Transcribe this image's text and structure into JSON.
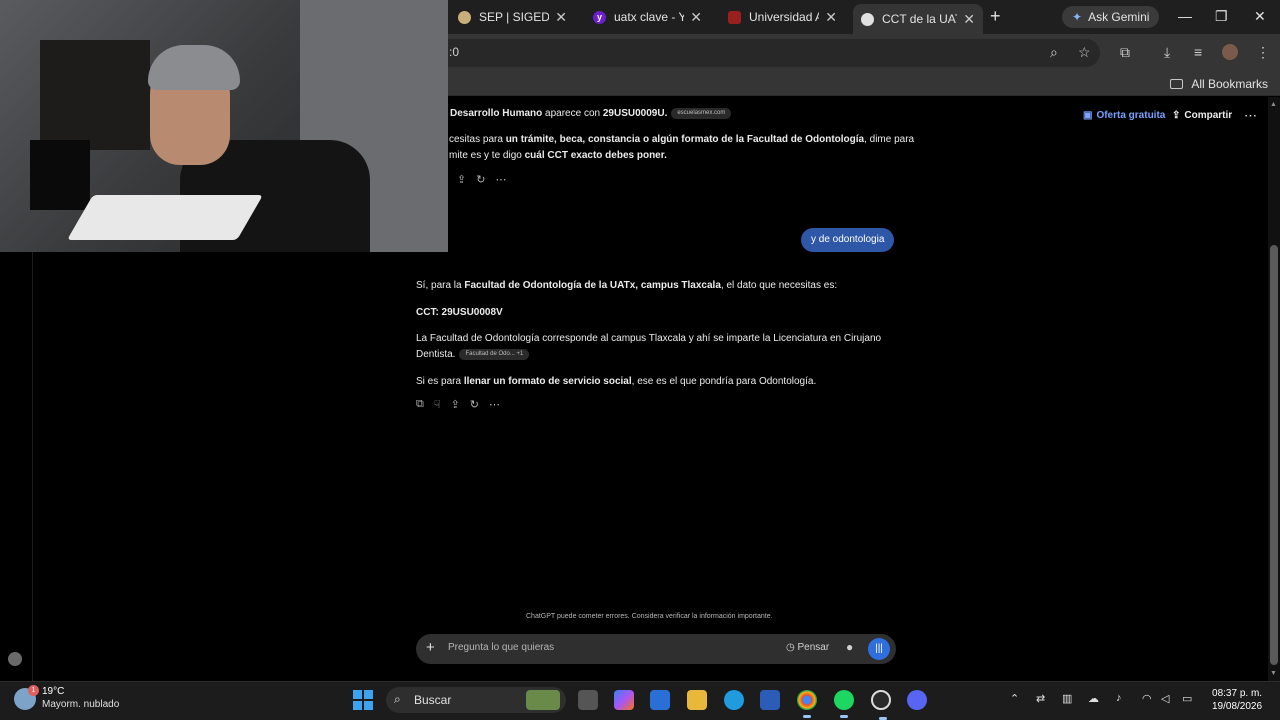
{
  "browser": {
    "tabs": [
      {
        "title": "SEP | SIGED",
        "close": "✕"
      },
      {
        "title": "uatx clave - Yaho",
        "close": "✕"
      },
      {
        "title": "Universidad Autó",
        "close": "✕"
      },
      {
        "title": "CCT de la UATx",
        "close": "✕"
      }
    ],
    "new_tab": "+",
    "ask_gemini": "Ask Gemini",
    "window_controls": {
      "minimize": "—",
      "maximize": "❐",
      "close": "✕"
    },
    "omnibox_text": ":0",
    "all_bookmarks": "All Bookmarks"
  },
  "chat_header": {
    "offer": "Oferta gratuita",
    "share": "Compartir",
    "more": "⋯"
  },
  "chat": {
    "prev_line_1a": "Desarrollo Humano",
    "prev_line_1b": " aparece con ",
    "prev_line_1c": "29USU0009U.",
    "prev_cite": "escuelasmex.com",
    "prev_line_2a": "cesitas para ",
    "prev_line_2b": "un trámite, beca, constancia o algún formato de la Facultad de Odontología",
    "prev_line_2c": ", dime para",
    "prev_line_3a": "mite es y te digo ",
    "prev_line_3b": "cuál CCT exacto debes poner.",
    "user_message": "y de odontologia",
    "r1a": "Sí, para la ",
    "r1b": "Facultad de Odontología de la UATx, campus Tlaxcala",
    "r1c": ", el dato que necesitas es:",
    "r2": "CCT: 29USU0008V",
    "r3": "La Facultad de Odontología corresponde al campus Tlaxcala y ahí se imparte la Licenciatura en Cirujano",
    "r4": "Dentista.",
    "r4_cite": "Facultad de Odo... +1",
    "r5a": "Si es para ",
    "r5b": "llenar un formato de servicio social",
    "r5c": ", ese es el que pondría para Odontología.",
    "disclaimer": "ChatGPT puede cometer errores. Considera verificar la información importante.",
    "composer_placeholder": "Pregunta lo que quieras",
    "think_label": "Pensar"
  },
  "taskbar": {
    "temperature": "19°C",
    "weather": "Mayorm. nublado",
    "weather_badge": "1",
    "search": "Buscar",
    "time": "08:37 p. m.",
    "date": "19/08/2026"
  },
  "colors": {
    "accent_blue": "#2f57a8",
    "offer_blue": "#7aa2ff",
    "tab_bg": "#1f1f1f",
    "toolbar_bg": "#353535"
  }
}
